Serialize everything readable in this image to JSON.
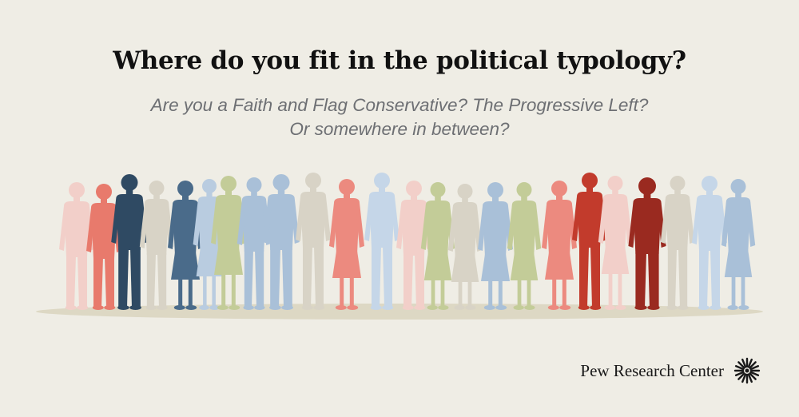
{
  "header": {
    "title": "Where do you fit in the political typology?",
    "subtitle_line1": "Are you a Faith and Flag Conservative? The Progressive Left?",
    "subtitle_line2": "Or somewhere in between?"
  },
  "crowd": {
    "figure_count": 26,
    "colors": [
      "#f2cfc9",
      "#e87a6c",
      "#2f4a63",
      "#d8d3c6",
      "#4a6b8a",
      "#b9cce0",
      "#c3cc98",
      "#a9c0d8",
      "#ec8a7f",
      "#c5d6e8",
      "#c23b2c",
      "#9a2a20"
    ],
    "ground_color": "#ddd8c4"
  },
  "footer": {
    "brand": "Pew Research Center",
    "logo_icon": "sunburst-logo-icon"
  }
}
